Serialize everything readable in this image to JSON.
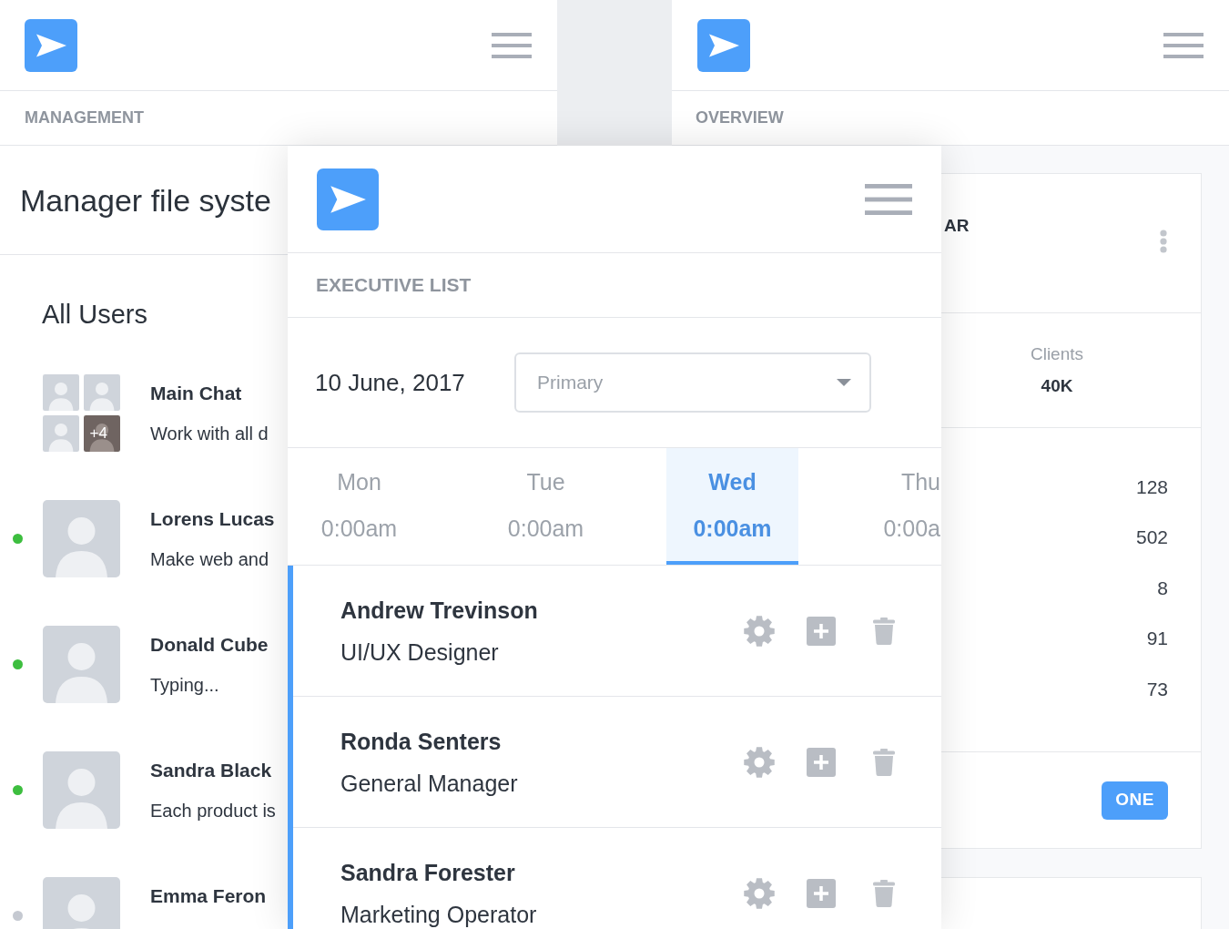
{
  "management_screen": {
    "section_label": "MANAGEMENT",
    "title": "Manager file syste",
    "list_heading": "All Users",
    "chats": [
      {
        "kind": "group",
        "name": "Main Chat",
        "message": "Work with all d",
        "extra_count": "+4"
      },
      {
        "kind": "person",
        "name": "Lorens Lucas",
        "message": "Make web and",
        "online": true
      },
      {
        "kind": "person",
        "name": "Donald Cube",
        "message": "Typing...",
        "online": true
      },
      {
        "kind": "person",
        "name": "Sandra Black",
        "message": "Each product is",
        "online": true
      },
      {
        "kind": "person",
        "name": "Emma Feron",
        "online": false
      }
    ]
  },
  "executive_screen": {
    "section_label": "EXECUTIVE LIST",
    "date": "10 June, 2017",
    "filter": {
      "placeholder": "Primary"
    },
    "days": [
      {
        "day": "Mon",
        "time": "0:00am",
        "selected": false
      },
      {
        "day": "Tue",
        "time": "0:00am",
        "selected": false
      },
      {
        "day": "Wed",
        "time": "0:00am",
        "selected": true
      },
      {
        "day": "Thu",
        "time": "0:00a",
        "selected": false
      }
    ],
    "executives": [
      {
        "name": "Andrew Trevinson",
        "role": "UI/UX Designer"
      },
      {
        "name": "Ronda Senters",
        "role": "General Manager"
      },
      {
        "name": "Sandra Forester",
        "role": "Marketing Operator"
      }
    ]
  },
  "overview_screen": {
    "section_label": "OVERVIEW",
    "card_title": "AR",
    "stat": {
      "label": "Clients",
      "value": "40K"
    },
    "values": [
      "128",
      "502",
      "8",
      "91",
      "73"
    ],
    "button": "ONE"
  }
}
